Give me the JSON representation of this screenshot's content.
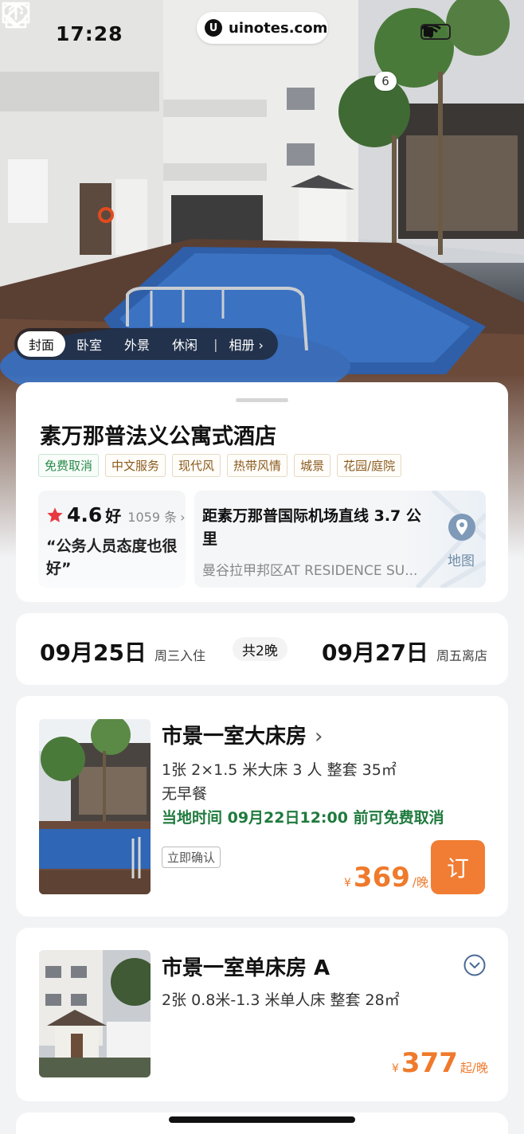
{
  "status_bar": {
    "time": "17:28",
    "url": "uinotes.com",
    "url_logo": "U"
  },
  "nav": {
    "favorites_count": "6"
  },
  "album_tabs": {
    "items": [
      "封面",
      "卧室",
      "外景",
      "休闲"
    ],
    "album_label": "相册 ›"
  },
  "hotel": {
    "name": "素万那普法义公寓式酒店",
    "tags": [
      "免费取消",
      "中文服务",
      "现代风",
      "热带风情",
      "城景",
      "花园/庭院"
    ]
  },
  "rating": {
    "score": "4.6",
    "word": "好",
    "count": "1059 条",
    "chevron": "›",
    "quote": "“公务人员态度也很好”"
  },
  "location": {
    "distance": "距素万那普国际机场直线 3.7 公里",
    "address": "曼谷拉甲邦区AT RESIDENCE SU...",
    "map_label": "地图"
  },
  "dates": {
    "checkin_date": "09月25日",
    "checkin_label": "周三入住",
    "nights": "共2晚",
    "checkout_date": "09月27日",
    "checkout_label": "周五离店"
  },
  "rooms": [
    {
      "title": "市景一室大床房",
      "chevron": "›",
      "bed": "1张 2×1.5 米大床 3 人 整套 35㎡",
      "breakfast": "无早餐",
      "cancel": "当地时间 09月22日12:00 前可免费取消",
      "confirm": "立即确认",
      "currency": "¥",
      "price": "369",
      "unit": "/晚",
      "book_label": "订"
    },
    {
      "title": "市景一室单床房 A",
      "bed": "2张 0.8米-1.3 米单人床 整套 28㎡",
      "currency": "¥",
      "price": "377",
      "unit": "起/晚"
    }
  ],
  "colors": {
    "accent": "#f07d33",
    "price": "#ef7a2b",
    "cancel_green": "#1f7a3d",
    "star": "#e8373f"
  }
}
